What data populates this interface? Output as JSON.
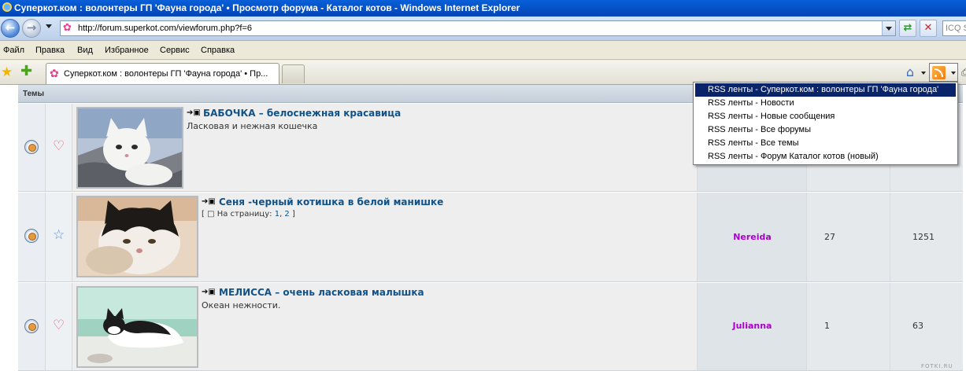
{
  "window": {
    "title": "Суперкот.ком : волонтеры ГП 'Фауна города' • Просмотр форума - Каталог котов - Windows Internet Explorer"
  },
  "address_bar": {
    "url": "http://forum.superkot.com/viewforum.php?f=6",
    "search_placeholder": "ICQ S"
  },
  "menu": {
    "items": [
      "Файл",
      "Правка",
      "Вид",
      "Избранное",
      "Сервис",
      "Справка"
    ]
  },
  "tabs": {
    "active_label": "Суперкот.ком : волонтеры ГП 'Фауна города' • Пр..."
  },
  "rss_menu": {
    "items": [
      "RSS ленты - Суперкот.ком : волонтеры ГП 'Фауна города'",
      "RSS ленты - Новости",
      "RSS ленты - Новые сообщения",
      "RSS ленты - Все форумы",
      "RSS ленты - Все темы",
      "RSS ленты - Форум Каталог котов (новый)"
    ],
    "active_index": 0
  },
  "forum": {
    "header_label": "Темы",
    "topics": [
      {
        "title": "БАБОЧКА – белоснежная красавица",
        "description": "Ласковая и нежная кошечка",
        "favorite": "heart",
        "author": "",
        "replies": "",
        "views": ""
      },
      {
        "title": "Сеня -черный котишка в белой манишке",
        "pages_prefix": "[",
        "pages_label": "На страницу:",
        "pages": [
          "1",
          "2"
        ],
        "pages_suffix": "]",
        "favorite": "star",
        "author": "Nereida",
        "replies": "27",
        "views": "1251"
      },
      {
        "title": "МЕЛИССА – очень ласковая малышка",
        "description": "Океан нежности.",
        "favorite": "heart",
        "author": "Julianna",
        "replies": "1",
        "views": "63"
      }
    ]
  },
  "watermark": "FOTKI.RU",
  "colors": {
    "link": "#105289",
    "author": "#aa00cc",
    "rss_active": "#0a246a",
    "titlebar": "#0453c8"
  }
}
